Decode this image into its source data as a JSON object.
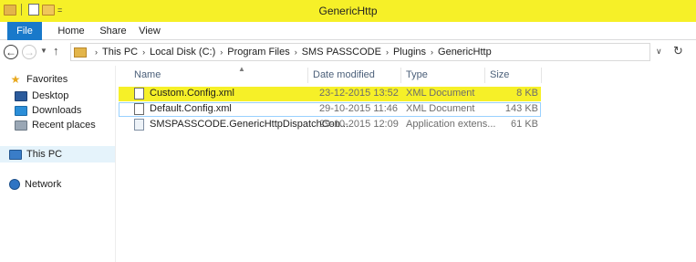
{
  "window": {
    "title": "GenericHttp",
    "qat_dropdown": "="
  },
  "ribbon": {
    "tabs": [
      "File",
      "Home",
      "Share",
      "View"
    ],
    "expand_icon": "chevron-down-icon"
  },
  "address": {
    "back_icon": "←",
    "forward_icon": "→",
    "up_icon": "↑",
    "crumbs": [
      "This PC",
      "Local Disk (C:)",
      "Program Files",
      "SMS PASSCODE",
      "Plugins",
      "GenericHttp"
    ],
    "separator": "›",
    "dropdown_icon": "∨",
    "refresh_icon": "↻"
  },
  "navpane": {
    "favorites": "Favorites",
    "desktop": "Desktop",
    "downloads": "Downloads",
    "recent": "Recent places",
    "thispc": "This PC",
    "network": "Network"
  },
  "list": {
    "columns": {
      "name": "Name",
      "date": "Date modified",
      "type": "Type",
      "size": "Size"
    },
    "sort_indicator": "▲",
    "rows": [
      {
        "name": "Custom.Config.xml",
        "date": "23-12-2015 13:52",
        "type": "XML Document",
        "size": "8 KB",
        "highlighted": true
      },
      {
        "name": "Default.Config.xml",
        "date": "29-10-2015 11:46",
        "type": "XML Document",
        "size": "143 KB",
        "selected": true
      },
      {
        "name": "SMSPASSCODE.GenericHttpDispatchCon...",
        "date": "29-10-2015 12:09",
        "type": "Application extens...",
        "size": "61 KB"
      }
    ]
  },
  "colors": {
    "title_bar": "#f6f028",
    "file_tab": "#1979ca",
    "highlight": "#f6f028",
    "selection_border": "#99d1ff",
    "header_text": "#4c607a"
  }
}
